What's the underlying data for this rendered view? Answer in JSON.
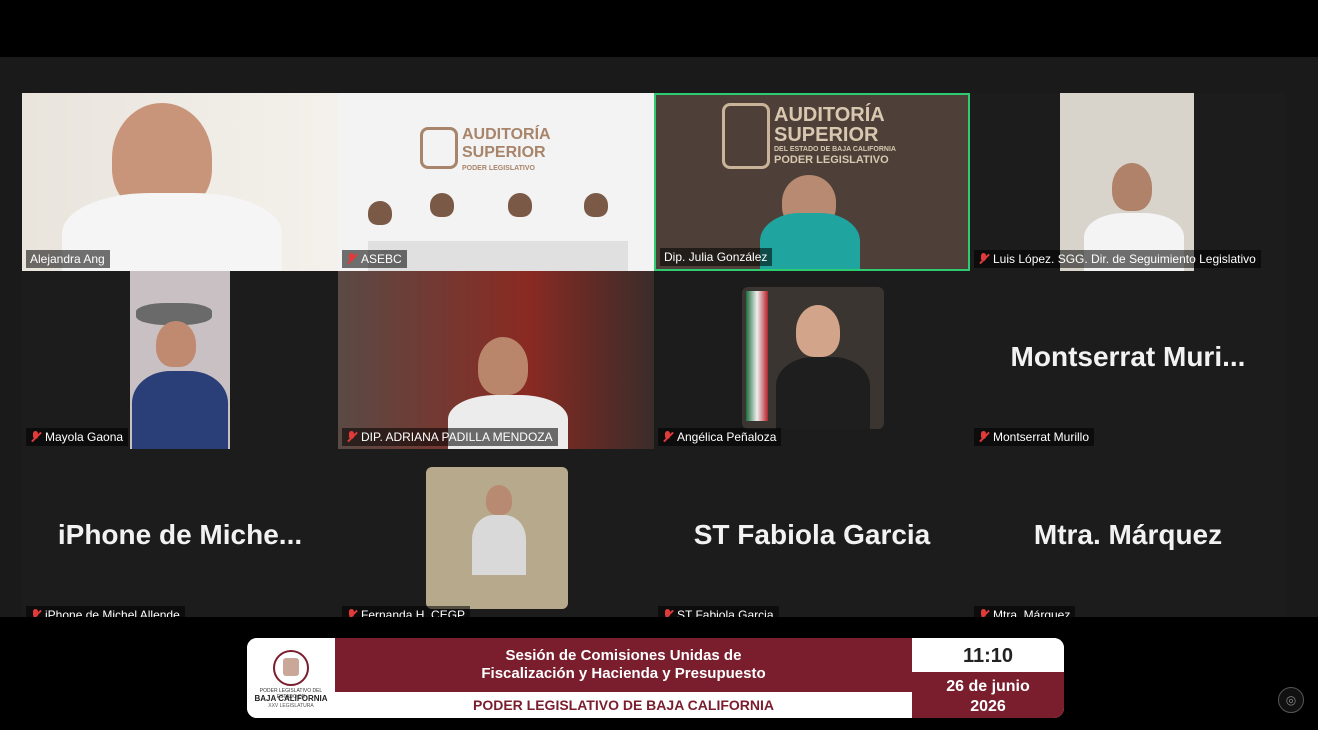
{
  "participants": [
    {
      "name": "Alejandra Ang",
      "muted": false
    },
    {
      "name": "ASEBC",
      "muted": true
    },
    {
      "name": "Dip. Julia González",
      "muted": false,
      "active_speaker": true
    },
    {
      "name": "Luis López. SGG. Dir. de Seguimiento Legislativo",
      "muted": true
    },
    {
      "name": "Mayola Gaona",
      "muted": true
    },
    {
      "name": "DIP. ADRIANA PADILLA MENDOZA",
      "muted": true
    },
    {
      "name": "Angélica Peñaloza",
      "muted": true
    },
    {
      "name": "Montserrat Murillo",
      "display": "Montserrat  Muri...",
      "muted": true
    },
    {
      "name": "iPhone de Michel Allende",
      "display": "iPhone  de  Miche...",
      "muted": true
    },
    {
      "name": "Fernanda H. CEGP",
      "muted": true
    },
    {
      "name": "ST Fabiola Garcia",
      "display": "ST Fabiola Garcia",
      "muted": true
    },
    {
      "name": "Mtra. Márquez",
      "display": "Mtra. Márquez",
      "muted": true
    }
  ],
  "backdrop": {
    "auditoria_line1": "AUDITORÍA",
    "auditoria_line2": "SUPERIOR",
    "auditoria_line3": "DEL ESTADO DE BAJA CALIFORNIA",
    "auditoria_line4": "PODER LEGISLATIVO"
  },
  "banner": {
    "logo_line1": "PODER LEGISLATIVO DEL ESTADO DE",
    "logo_line2": "BAJA CALIFORNIA",
    "logo_line3": "XXV LEGISLATURA",
    "title_line1": "Sesión de Comisiones Unidas de",
    "title_line2": "Fiscalización y Hacienda y Presupuesto",
    "subtitle": "PODER LEGISLATIVO DE BAJA CALIFORNIA",
    "time": "11:10",
    "date_line1": "26 de junio",
    "date_line2": "2026"
  },
  "colors": {
    "brand_maroon": "#7a1e2e",
    "active_speaker_border": "#2ecc71",
    "muted_icon": "#e03a3a"
  }
}
